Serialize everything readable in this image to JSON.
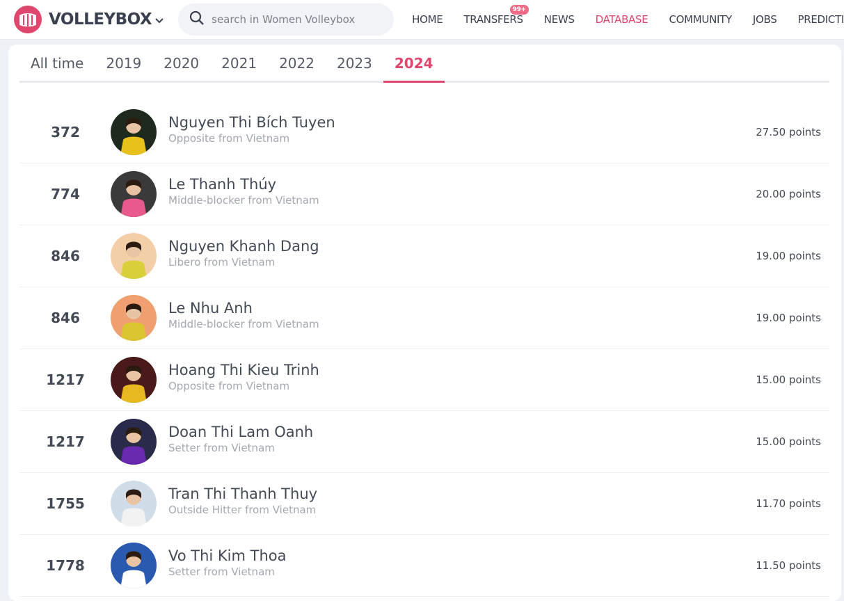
{
  "header": {
    "logo_text": "VOLLEYBOX",
    "search_placeholder": "search in Women Volleybox",
    "nav": [
      {
        "label": "HOME"
      },
      {
        "label": "TRANSFERS",
        "badge": "99+"
      },
      {
        "label": "NEWS"
      },
      {
        "label": "DATABASE"
      },
      {
        "label": "COMMUNITY"
      },
      {
        "label": "JOBS"
      },
      {
        "label": "PREDICTIONS"
      }
    ]
  },
  "tabs": [
    "All time",
    "2019",
    "2020",
    "2021",
    "2022",
    "2023",
    "2024"
  ],
  "active_tab": "2024",
  "colors": {
    "accent": "#e0476f",
    "text": "#444a55",
    "muted": "#a4a8b0"
  },
  "players": [
    {
      "rank": "372",
      "name": "Nguyen Thi Bích Tuyen",
      "desc": "Opposite from Vietnam",
      "points": "27.50 points",
      "avatar_bg": "#1f2a1f",
      "jersey": "#e8c21a"
    },
    {
      "rank": "774",
      "name": "Le Thanh Thúy",
      "desc": "Middle-blocker from Vietnam",
      "points": "20.00 points",
      "avatar_bg": "#3a3a3a",
      "jersey": "#e85a8c"
    },
    {
      "rank": "846",
      "name": "Nguyen Khanh Dang",
      "desc": "Libero from Vietnam",
      "points": "19.00 points",
      "avatar_bg": "#f2cfa6",
      "jersey": "#d8d03a"
    },
    {
      "rank": "846",
      "name": "Le Nhu Anh",
      "desc": "Middle-blocker from Vietnam",
      "points": "19.00 points",
      "avatar_bg": "#f0a070",
      "jersey": "#d9c630"
    },
    {
      "rank": "1217",
      "name": "Hoang Thi Kieu Trinh",
      "desc": "Opposite from Vietnam",
      "points": "15.00 points",
      "avatar_bg": "#4a1a1a",
      "jersey": "#e8b820"
    },
    {
      "rank": "1217",
      "name": "Doan Thi Lam Oanh",
      "desc": "Setter from Vietnam",
      "points": "15.00 points",
      "avatar_bg": "#2a2a4a",
      "jersey": "#6a2ab0"
    },
    {
      "rank": "1755",
      "name": "Tran Thi Thanh Thuy",
      "desc": "Outside Hitter from Vietnam",
      "points": "11.70 points",
      "avatar_bg": "#d0dce8",
      "jersey": "#f2f2f2"
    },
    {
      "rank": "1778",
      "name": "Vo Thi Kim Thoa",
      "desc": "Setter from Vietnam",
      "points": "11.50 points",
      "avatar_bg": "#2a5ab0",
      "jersey": "#ffffff"
    }
  ]
}
